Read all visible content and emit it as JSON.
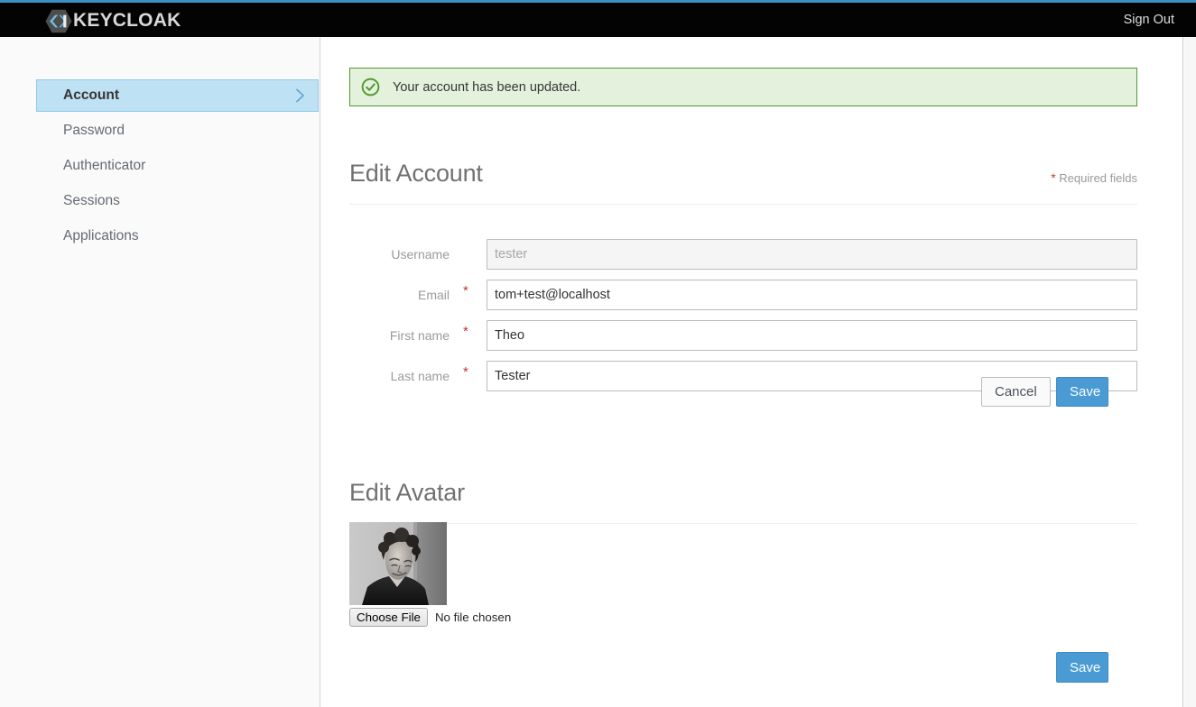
{
  "brand": {
    "name": "KEYCLOAK",
    "logo_icon": "keycloak-hexagon-logo"
  },
  "navbar": {
    "sign_out_label": "Sign Out"
  },
  "sidebar": {
    "items": [
      {
        "label": "Account",
        "active": true,
        "chevron_icon": "chevron-right-icon"
      },
      {
        "label": "Password",
        "active": false
      },
      {
        "label": "Authenticator",
        "active": false
      },
      {
        "label": "Sessions",
        "active": false
      },
      {
        "label": "Applications",
        "active": false
      }
    ]
  },
  "alert": {
    "icon": "check-circle-icon",
    "message": "Your account has been updated.",
    "type": "success",
    "bg_color": "#e4f1dc",
    "border_color": "#4f9a2e",
    "icon_color": "#4f9a2e"
  },
  "account_section": {
    "title": "Edit Account",
    "required_star": "*",
    "required_label": "Required fields",
    "fields": [
      {
        "label": "Username",
        "required": false,
        "star": "",
        "value": "",
        "placeholder": "tester",
        "disabled": true
      },
      {
        "label": "Email",
        "required": true,
        "star": "*",
        "value": "tom+test@localhost",
        "placeholder": "",
        "disabled": false
      },
      {
        "label": "First name",
        "required": true,
        "star": "*",
        "value": "Theo",
        "placeholder": "",
        "disabled": false
      },
      {
        "label": "Last name",
        "required": true,
        "star": "*",
        "value": "Tester",
        "placeholder": "",
        "disabled": false
      }
    ],
    "cancel_label": "Cancel",
    "save_label": "Save"
  },
  "avatar_section": {
    "title": "Edit Avatar",
    "image_alt": "grayscale-portrait-of-man-looking-down",
    "choose_file_label": "Choose File",
    "no_file_label": "No file chosen",
    "save_label": "Save"
  },
  "colors": {
    "accent_blue": "#4a9bd4",
    "top_stripe": "#3c8ec6",
    "navbar_bg": "#030303",
    "sidebar_active_bg": "#bee1f4",
    "required_red": "#c0392b"
  }
}
